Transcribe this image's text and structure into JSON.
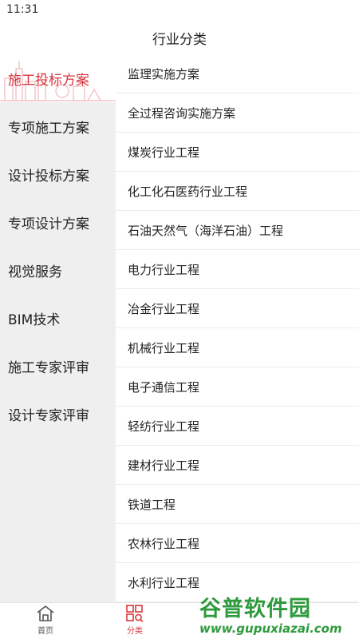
{
  "status_bar": {
    "time": "11:31"
  },
  "header": {
    "title": "行业分类"
  },
  "sidebar": {
    "items": [
      {
        "label": "施工投标方案",
        "active": true
      },
      {
        "label": "专项施工方案"
      },
      {
        "label": "设计投标方案"
      },
      {
        "label": "专项设计方案"
      },
      {
        "label": "视觉服务"
      },
      {
        "label": "BIM技术"
      },
      {
        "label": "施工专家评审"
      },
      {
        "label": "设计专家评审"
      }
    ]
  },
  "content": {
    "items": [
      "监理实施方案",
      "全过程咨询实施方案",
      "煤炭行业工程",
      "化工化石医药行业工程",
      "石油天然气（海洋石油）工程",
      "电力行业工程",
      "冶金行业工程",
      "机械行业工程",
      "电子通信工程",
      "轻纺行业工程",
      "建材行业工程",
      "铁道工程",
      "农林行业工程",
      "水利行业工程"
    ]
  },
  "tabbar": {
    "tabs": [
      {
        "label": "首页",
        "icon": "home-icon"
      },
      {
        "label": "分类",
        "icon": "category-icon",
        "active": true
      }
    ]
  },
  "watermark": {
    "title": "谷普软件园",
    "url": "www.gupuxiazai.com"
  },
  "colors": {
    "accent": "#d9363e",
    "sidebar_bg": "#efefef",
    "watermark": "#2e9a3c"
  }
}
